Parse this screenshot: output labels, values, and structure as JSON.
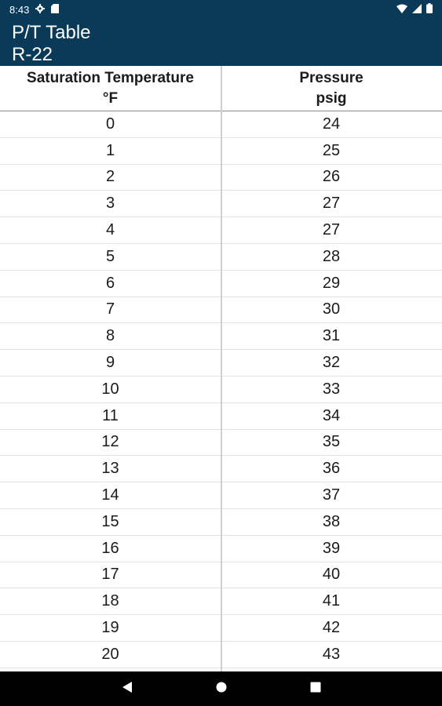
{
  "status_bar": {
    "time": "8:43",
    "icons": [
      "gear-icon",
      "sd-card-icon",
      "wifi-icon",
      "signal-icon",
      "battery-icon"
    ]
  },
  "app_bar": {
    "title": "P/T Table",
    "subtitle": "R-22"
  },
  "table": {
    "headers": [
      {
        "line1": "Saturation Temperature",
        "line2": "°F"
      },
      {
        "line1": "Pressure",
        "line2": "psig"
      }
    ],
    "rows": [
      {
        "temp": "0",
        "pressure": "24"
      },
      {
        "temp": "1",
        "pressure": "25"
      },
      {
        "temp": "2",
        "pressure": "26"
      },
      {
        "temp": "3",
        "pressure": "27"
      },
      {
        "temp": "4",
        "pressure": "27"
      },
      {
        "temp": "5",
        "pressure": "28"
      },
      {
        "temp": "6",
        "pressure": "29"
      },
      {
        "temp": "7",
        "pressure": "30"
      },
      {
        "temp": "8",
        "pressure": "31"
      },
      {
        "temp": "9",
        "pressure": "32"
      },
      {
        "temp": "10",
        "pressure": "33"
      },
      {
        "temp": "11",
        "pressure": "34"
      },
      {
        "temp": "12",
        "pressure": "35"
      },
      {
        "temp": "13",
        "pressure": "36"
      },
      {
        "temp": "14",
        "pressure": "37"
      },
      {
        "temp": "15",
        "pressure": "38"
      },
      {
        "temp": "16",
        "pressure": "39"
      },
      {
        "temp": "17",
        "pressure": "40"
      },
      {
        "temp": "18",
        "pressure": "41"
      },
      {
        "temp": "19",
        "pressure": "42"
      },
      {
        "temp": "20",
        "pressure": "43"
      }
    ]
  },
  "nav_bar": {
    "buttons": [
      "back-icon",
      "home-icon",
      "recents-icon"
    ]
  },
  "colors": {
    "app_bar_bg": "#0a3a57",
    "nav_bar_bg": "#000000",
    "text": "#1b1b1b"
  }
}
